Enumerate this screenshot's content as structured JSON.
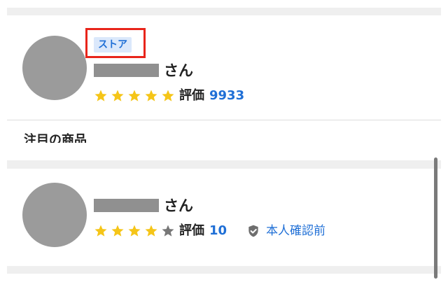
{
  "colors": {
    "accent": "#1f6fd6",
    "star_filled": "#f5c518",
    "star_empty": "#777777",
    "highlight": "#e8251b"
  },
  "sellers": [
    {
      "badge": "ストア",
      "honorific": "さん",
      "rating_label": "評価",
      "rating_count": "9933",
      "stars_filled": 5,
      "stars_total": 5
    },
    {
      "honorific": "さん",
      "rating_label": "評価",
      "rating_count": "10",
      "stars_filled": 4,
      "stars_total": 5,
      "verification": {
        "icon": "shield-check-icon",
        "label": "本人確認前"
      }
    }
  ],
  "section": {
    "heading": "注目の商品"
  }
}
